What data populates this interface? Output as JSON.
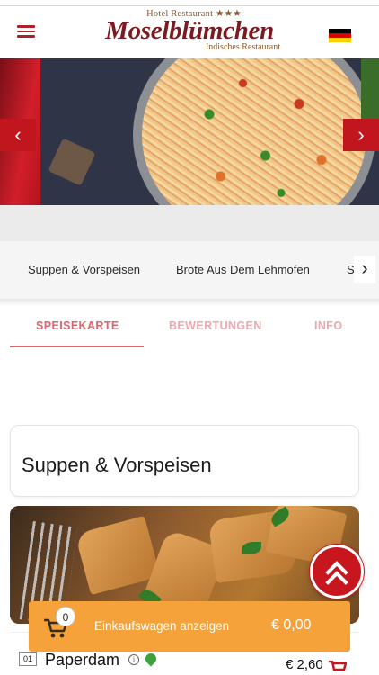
{
  "header": {
    "logo_top": "Hotel Restaurant ★★★",
    "logo_main": "Moselblümchen",
    "logo_sub": "Indisches Restaurant",
    "menu_icon": "hamburger-menu-icon",
    "language_icon": "german-flag-icon",
    "flag_colors": [
      "#000000",
      "#dd0000",
      "#ffce00"
    ]
  },
  "hero": {
    "prev_icon": "chevron-left-icon",
    "next_icon": "chevron-right-icon",
    "prev_glyph": "‹",
    "next_glyph": "›"
  },
  "categories": {
    "items": [
      "Suppen & Vorspeisen",
      "Brote Aus Dem Lehmofen",
      "Sa"
    ],
    "next_glyph": "›"
  },
  "tabs": [
    {
      "label": "SPEISEKARTE",
      "active": true
    },
    {
      "label": "BEWERTUNGEN",
      "active": false
    },
    {
      "label": "INFO",
      "active": false
    }
  ],
  "section": {
    "title": "Suppen & Vorspeisen"
  },
  "cart": {
    "count": "0",
    "label": "Einkaufswagen anzeigen",
    "total": "€ 0,00",
    "color": "#f5a23a"
  },
  "item": {
    "number": "01",
    "name": "Paperdam",
    "price": "€ 2,60",
    "info_glyph": "i"
  },
  "colors": {
    "brand_red": "#c2161f",
    "tab_active": "#e0646c",
    "tab_inactive": "#f0a8ad"
  }
}
